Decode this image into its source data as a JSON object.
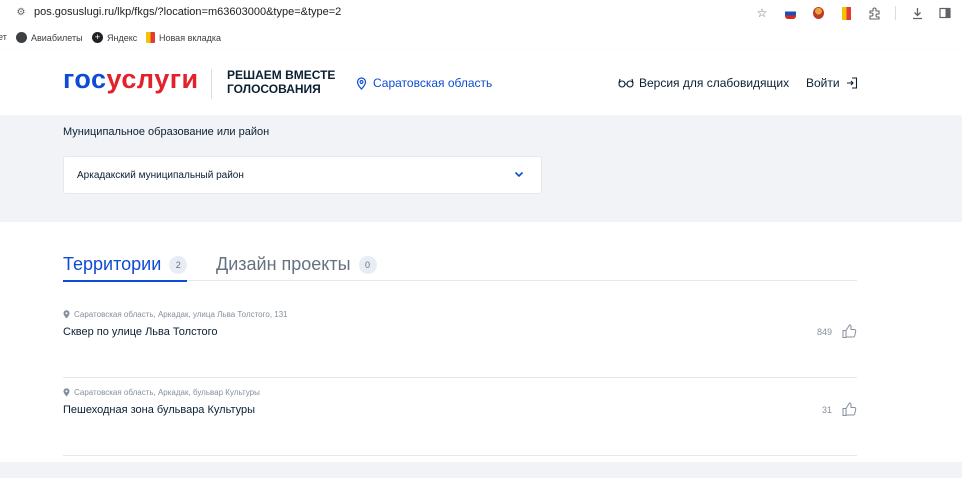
{
  "browser": {
    "url": "pos.gosuslugi.ru/lkp/fkgs/?location=m63603000&type=&type=2",
    "icons": [
      "site-settings-icon",
      "star-icon",
      "flag-extension-icon",
      "extension-icon",
      "bookmark-extension-icon",
      "puzzle-icon",
      "download-icon",
      "sidebar-icon"
    ],
    "bookmarks": [
      {
        "label": "ет",
        "icon": "partial-icon"
      },
      {
        "label": "Авиабилеты",
        "icon": "globe-icon"
      },
      {
        "label": "Яндекс",
        "icon": "plus-icon"
      },
      {
        "label": "Новая вкладка",
        "icon": "bookmark-icon"
      }
    ]
  },
  "header": {
    "logo_part1": "гос",
    "logo_part2": "услуги",
    "slogan_line1": "РЕШАЕМ ВМЕСТЕ",
    "slogan_line2": "ГОЛОСОВАНИЯ",
    "region": "Саратовская область",
    "low_vision": "Версия для слабовидящих",
    "login": "Войти"
  },
  "filter": {
    "label": "Муниципальное образование или район",
    "selected": "Аркадакский муниципальный район"
  },
  "tabs": [
    {
      "label": "Территории",
      "count": "2",
      "active": true
    },
    {
      "label": "Дизайн проекты",
      "count": "0",
      "active": false
    }
  ],
  "items": [
    {
      "address": "Саратовская область, Аркадак, улица Льва Толстого, 131",
      "title": "Сквер по улице Льва Толстого",
      "likes": "849"
    },
    {
      "address": "Саратовская область, Аркадак, бульвар Культуры",
      "title": "Пешеходная зона бульвара Культуры",
      "likes": "31"
    }
  ],
  "colors": {
    "brand_blue": "#0d4cd3",
    "brand_red": "#e4202a",
    "background_gray": "#f1f3f6"
  }
}
